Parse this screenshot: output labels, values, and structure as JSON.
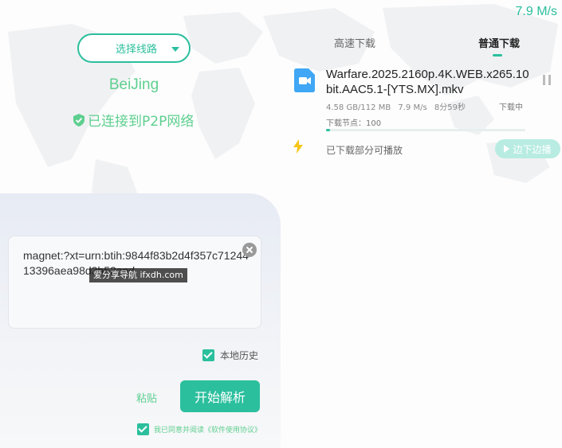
{
  "header": {
    "speed": "7.9 M/s"
  },
  "connection": {
    "route_label": "选择线路",
    "city": "BeiJing",
    "status": "已连接到P2P网络"
  },
  "tabs": [
    {
      "label": "高速下载",
      "active": false
    },
    {
      "label": "普通下载",
      "active": true
    }
  ],
  "task": {
    "file_name": "Warfare.2025.2160p.4K.WEB.x265.10bit.AAC5.1-[YTS.MX].mkv",
    "size": "4.58 GB/112 MB",
    "speed": "7.9 M/s",
    "eta": "8分59秒",
    "status": "下载中",
    "nodes": "下载节点：100",
    "progress": 0.02
  },
  "play": {
    "hint": "已下载部分可播放",
    "button_label": "边下边播"
  },
  "input": {
    "value": "magnet:?xt=urn:btih:9844f83b2d4f357c7124413396aea98d3b52aed",
    "watermark": "爱分享导航 ifxdh.com"
  },
  "history": {
    "label": "本地历史",
    "checked": true
  },
  "actions": {
    "paste_label": "粘贴",
    "parse_label": "开始解析"
  },
  "agreement": {
    "label": "我已同意并阅读《软件使用协议》",
    "checked": true
  },
  "colors": {
    "accent": "#2bbf9d",
    "green_text": "#5ecf8f"
  }
}
